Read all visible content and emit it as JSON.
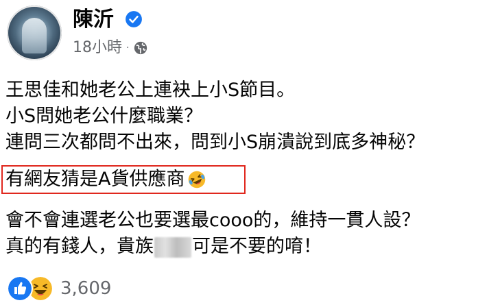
{
  "post": {
    "author": {
      "name": "陳沂",
      "verified": true,
      "avatar_icon": "profile-avatar"
    },
    "timestamp": "18小時",
    "separator": "·",
    "audience_icon": "globe-icon",
    "text": {
      "line1": "王思佳和她老公上連袂上小S節目。",
      "line2": "小S問她老公什麼職業？",
      "line3": "連問三次都問不出來，問到小S崩潰說到底多神秘？",
      "line4": "有網友猜是A貨供應商",
      "line4_emoji": "rolling-on-floor-laughing",
      "line5": "會不會連選老公也要選最cooo的，維持一貫人設？",
      "line6_before": "真的有錢人，貴族",
      "line6_after": "可是不要的唷！"
    },
    "highlight_color": "#e0271d",
    "reactions": {
      "types": [
        "like",
        "haha"
      ],
      "count": "3,609"
    },
    "colors": {
      "text": "#050505",
      "secondary": "#65676b",
      "facebook_blue": "#1877f2"
    }
  }
}
